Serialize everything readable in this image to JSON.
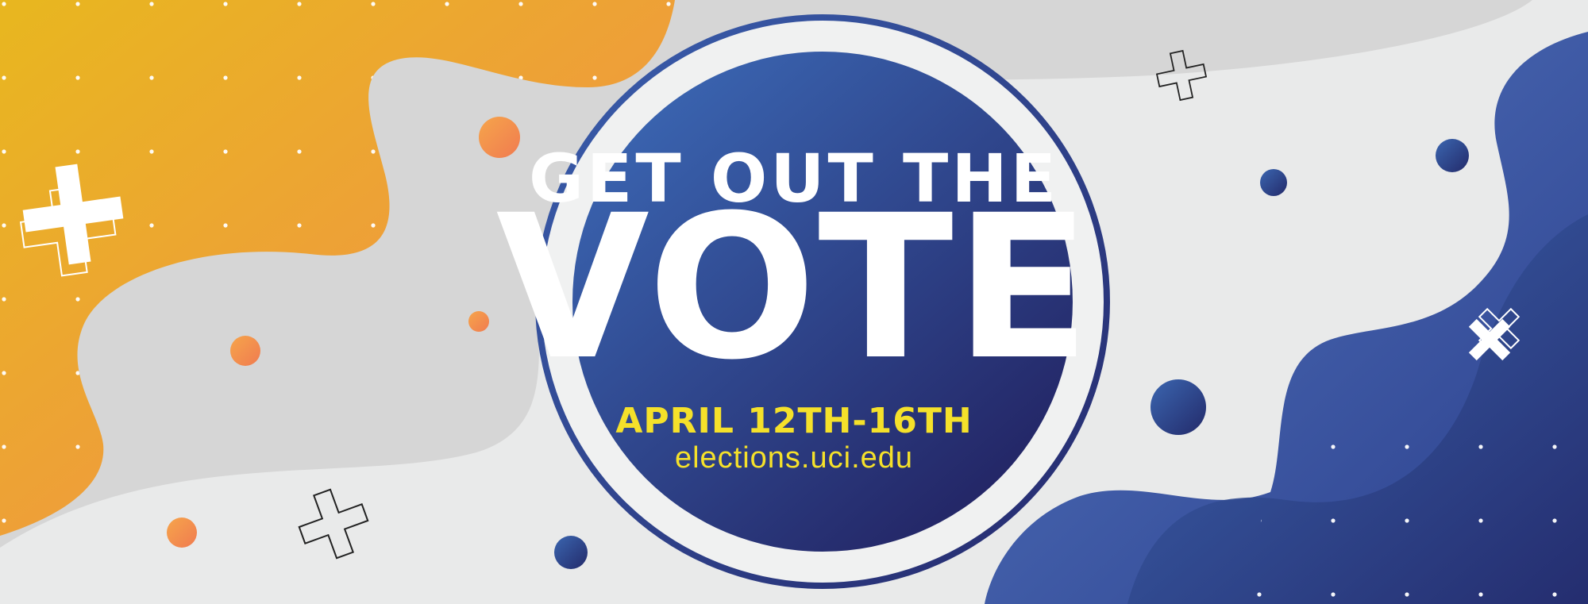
{
  "headline": {
    "line1": "GET OUT THE",
    "line2": "VOTE"
  },
  "event": {
    "dates": "APRIL 12TH-16TH",
    "url": "elections.uci.edu"
  },
  "colors": {
    "background": "#e9eaea",
    "gray_wave": "#d6d6d6",
    "orange_start": "#e8b71f",
    "orange_end": "#f38a4f",
    "blue_light": "#3b66b0",
    "blue_dark": "#232a6a",
    "accent_yellow": "#f5e12a",
    "text_white": "#ffffff"
  },
  "icons": [
    "plus-icon",
    "plus-outline-icon",
    "x-icon",
    "dot-grid",
    "circle-dot"
  ]
}
